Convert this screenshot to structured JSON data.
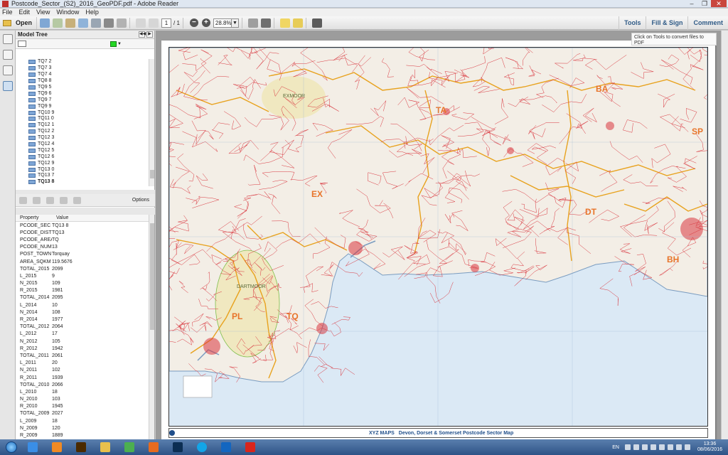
{
  "window": {
    "title": "Postcode_Sector_(S2)_2016_GeoPDF.pdf - Adobe Reader",
    "controls": [
      "–",
      "❐",
      "✕"
    ]
  },
  "menu": [
    "File",
    "Edit",
    "View",
    "Window",
    "Help"
  ],
  "toolbar": {
    "open_label": "Open",
    "page_current": "1",
    "page_total": "/ 1",
    "zoom_value": "28.8%",
    "right_tabs": [
      "Tools",
      "Fill & Sign",
      "Comment"
    ]
  },
  "model_tree": {
    "title": "Model Tree",
    "items": [
      "TQ7 2",
      "TQ7 3",
      "TQ7 4",
      "TQ8 8",
      "TQ9 5",
      "TQ9 6",
      "TQ9 7",
      "TQ9 9",
      "TQ10 9",
      "TQ11 0",
      "TQ12 1",
      "TQ12 2",
      "TQ12 3",
      "TQ12 4",
      "TQ12 5",
      "TQ12 6",
      "TQ12 9",
      "TQ13 0",
      "TQ13 7",
      "TQ13 8"
    ],
    "selected": "TQ13 8",
    "layer_color": "#24d724",
    "options_label": "Options"
  },
  "properties": {
    "header": [
      "Property",
      "Value"
    ],
    "rows": [
      [
        "PCODE_SEC",
        "TQ13 8"
      ],
      [
        "PCODE_DIST",
        "TQ13"
      ],
      [
        "PCODE_AREA",
        "TQ"
      ],
      [
        "PCODE_NUM",
        "13"
      ],
      [
        "POST_TOWN",
        "Torquay"
      ],
      [
        "AREA_SQKM",
        "119.5676"
      ],
      [
        "TOTAL_2015",
        "2099"
      ],
      [
        "L_2015",
        "9"
      ],
      [
        "N_2015",
        "109"
      ],
      [
        "R_2015",
        "1981"
      ],
      [
        "TOTAL_2014",
        "2095"
      ],
      [
        "L_2014",
        "10"
      ],
      [
        "N_2014",
        "108"
      ],
      [
        "R_2014",
        "1977"
      ],
      [
        "TOTAL_2012",
        "2064"
      ],
      [
        "L_2012",
        "17"
      ],
      [
        "N_2012",
        "105"
      ],
      [
        "R_2012",
        "1942"
      ],
      [
        "TOTAL_2011",
        "2061"
      ],
      [
        "L_2011",
        "20"
      ],
      [
        "N_2011",
        "102"
      ],
      [
        "R_2011",
        "1939"
      ],
      [
        "TOTAL_2010",
        "2066"
      ],
      [
        "L_2010",
        "18"
      ],
      [
        "N_2010",
        "103"
      ],
      [
        "R_2010",
        "1945"
      ],
      [
        "TOTAL_2009",
        "2027"
      ],
      [
        "L_2009",
        "18"
      ],
      [
        "N_2009",
        "120"
      ],
      [
        "R_2009",
        "1889"
      ]
    ]
  },
  "document": {
    "convert_tip": "Click on Tools to convert files to PDF",
    "map_labels": [
      "TA",
      "BA",
      "SP",
      "EX",
      "DT",
      "BH",
      "PL",
      "TQ",
      "DARTMOOR",
      "EXMOOR"
    ],
    "footer_brand": "XYZ MAPS",
    "footer_title": "Devon, Dorset & Somerset Postcode Sector Map"
  },
  "taskbar": {
    "apps": [
      "ie",
      "media",
      "illustrator",
      "explorer",
      "chrome",
      "firefox",
      "photoshop",
      "skype",
      "outlook",
      "acrobat"
    ],
    "lang": "EN",
    "time": "13:36",
    "date": "08/06/2016"
  },
  "colors": {
    "sea": "#dbe9f5",
    "land": "#f3eee6",
    "sector_lines": "#d9363e",
    "area_lines": "#e8a21e",
    "label": "#e8742a"
  }
}
